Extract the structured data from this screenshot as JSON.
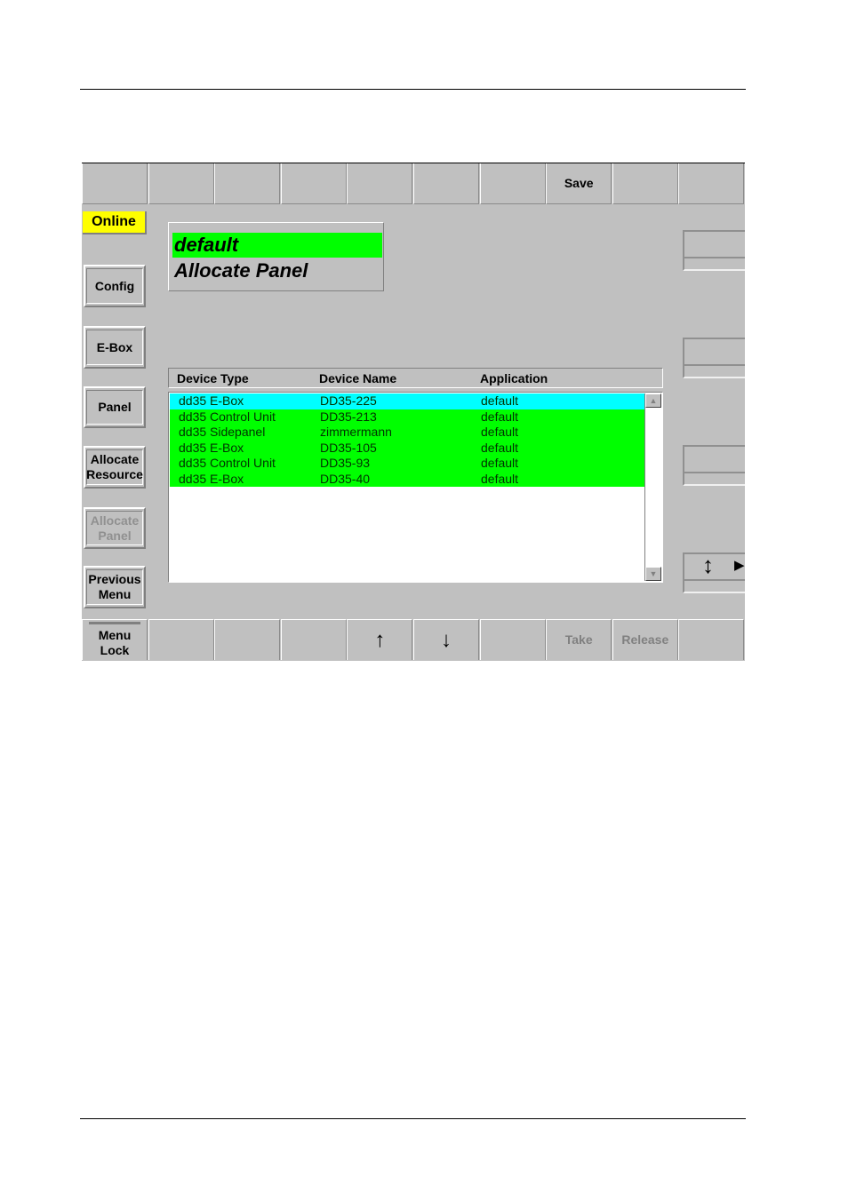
{
  "top_bar": {
    "buttons": [
      "",
      "",
      "",
      "",
      "",
      "",
      "",
      "Save",
      "",
      ""
    ]
  },
  "status": {
    "online_label": "Online",
    "online_color": "#ffff00"
  },
  "title_box": {
    "line1": "default",
    "line2": "Allocate Panel",
    "highlight_color": "#00ff00"
  },
  "sidebar": {
    "config": "Config",
    "ebox": "E-Box",
    "panel": "Panel",
    "allocate_resource_1": "Allocate",
    "allocate_resource_2": "Resource",
    "allocate_panel_1": "Allocate",
    "allocate_panel_2": "Panel",
    "previous_menu_1": "Previous",
    "previous_menu_2": "Menu"
  },
  "table": {
    "columns": [
      "Device Type",
      "Device Name",
      "Application"
    ],
    "rows": [
      {
        "type": "dd35 E-Box",
        "name": "DD35-225",
        "app": "default",
        "color": "#00ffff"
      },
      {
        "type": "dd35 Control Unit",
        "name": "DD35-213",
        "app": "default",
        "color": "#00ff00"
      },
      {
        "type": "dd35 Sidepanel",
        "name": "zimmermann",
        "app": "default",
        "color": "#00ff00"
      },
      {
        "type": "dd35 E-Box",
        "name": "DD35-105",
        "app": "default",
        "color": "#00ff00"
      },
      {
        "type": "dd35 Control Unit",
        "name": "DD35-93",
        "app": "default",
        "color": "#00ff00"
      },
      {
        "type": "dd35 E-Box",
        "name": "DD35-40",
        "app": "default",
        "color": "#00ff00"
      }
    ]
  },
  "bottom_bar": {
    "menu_lock_1": "Menu",
    "menu_lock_2": "Lock",
    "up_icon": "↑",
    "down_icon": "↓",
    "take": "Take",
    "release": "Release"
  },
  "right_panel": {
    "vertical_arrow_icon": "↕",
    "right_arrow_icon": "▶"
  }
}
